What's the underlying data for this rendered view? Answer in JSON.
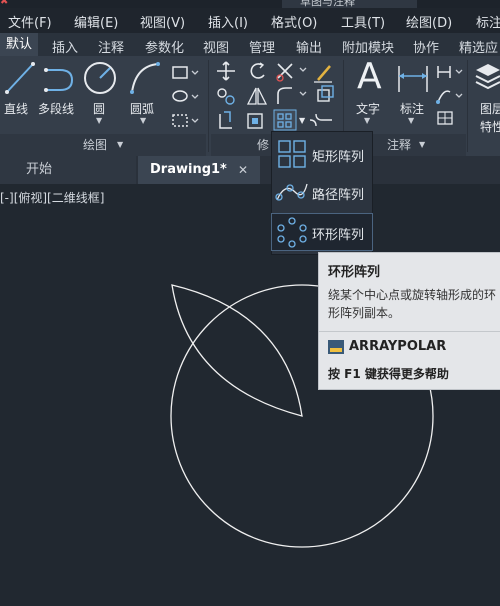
{
  "title_fragment": "草图与注释",
  "menu": [
    "文件(F)",
    "编辑(E)",
    "视图(V)",
    "插入(I)",
    "格式(O)",
    "工具(T)",
    "绘图(D)",
    "标注"
  ],
  "ribbon_tabs": [
    "默认",
    "插入",
    "注释",
    "参数化",
    "视图",
    "管理",
    "输出",
    "附加模块",
    "协作",
    "精选应"
  ],
  "draw_tools": [
    "直线",
    "多段线",
    "圆",
    "圆弧"
  ],
  "panels": {
    "draw": "绘图",
    "modify": "修",
    "annotation": "注释"
  },
  "annotation_tools": [
    "文字",
    "标注"
  ],
  "layer_tools": [
    "图层",
    "特性"
  ],
  "doc_tabs": {
    "start": "开始",
    "drawing": "Drawing1*",
    "close": "✕"
  },
  "viewport_label": "[-][俯视][二维线框]",
  "flyout": [
    "矩形阵列",
    "路径阵列",
    "环形阵列"
  ],
  "tooltip": {
    "title": "环形阵列",
    "desc": "绕某个中心点或旋转轴形成的环形阵列副本。",
    "command": "ARRAYPOLAR",
    "help": "按 F1 键获得更多帮助"
  },
  "colors": {
    "background": "#212830",
    "ribbon": "#353e4a",
    "accent": "#6fb1e6",
    "drawing": "#f0f0f0"
  }
}
